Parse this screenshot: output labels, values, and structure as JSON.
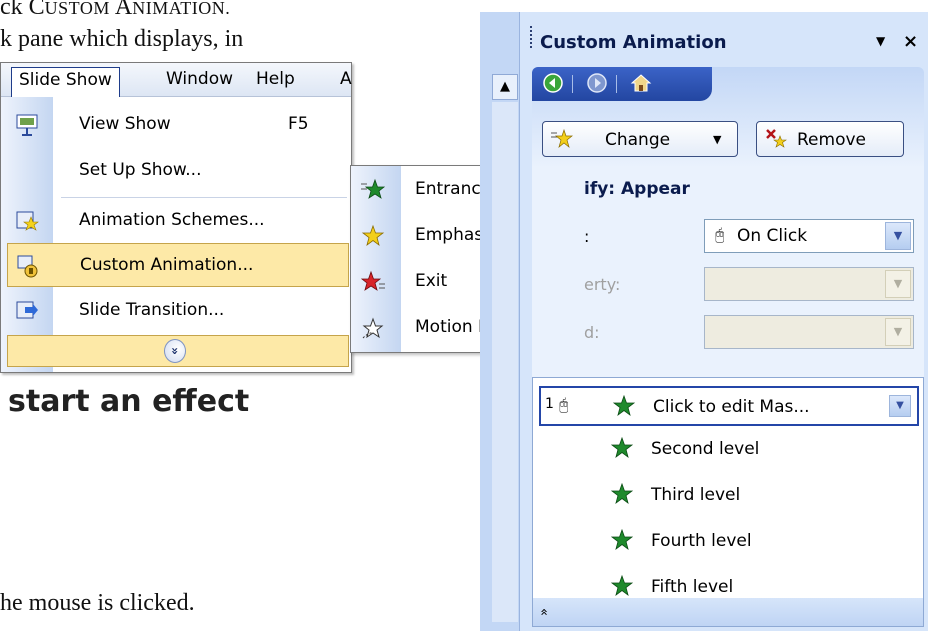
{
  "document": {
    "line1_prefix": "ck ",
    "line1_sc_big1": "C",
    "line1_sc_small1": "USTOM ",
    "line1_sc_big2": "A",
    "line1_sc_small2": "NIMATION.",
    "line2": "k pane which displays, in",
    "heading": "start an effect",
    "footer_line": "he mouse is clicked."
  },
  "menubar": {
    "items": [
      {
        "label": "Slide Show"
      },
      {
        "label": "Window"
      },
      {
        "label": "Help"
      },
      {
        "label": "A"
      }
    ]
  },
  "slide_show_menu": {
    "items": [
      {
        "label": "View Show",
        "shortcut": "F5",
        "icon": "projector-screen-icon"
      },
      {
        "label": "Set Up Show...",
        "icon": ""
      },
      {
        "label": "Animation Schemes...",
        "icon": "animation-schemes-icon"
      },
      {
        "label": "Custom Animation...",
        "icon": "custom-animation-icon"
      },
      {
        "label": "Slide Transition...",
        "icon": "slide-transition-icon"
      }
    ],
    "expand_glyph": "»"
  },
  "effect_submenu": {
    "items": [
      {
        "label": "Entrance",
        "icon": "green-star-icon",
        "color": "#1f8a2c"
      },
      {
        "label": "Emphasis",
        "icon": "yellow-star-icon",
        "color": "#f3cf1a"
      },
      {
        "label": "Exit",
        "icon": "red-star-icon",
        "color": "#d8242a"
      },
      {
        "label": "Motion Paths",
        "icon": "outline-star-icon",
        "color": "#ffffff"
      }
    ]
  },
  "task_pane": {
    "title": "Custom Animation",
    "dropdown_glyph": "▼",
    "close_glyph": "×",
    "change_button": "Change",
    "remove_button": "Remove",
    "modify_label": "ify: Appear",
    "start_label": ":",
    "start_value": "On Click",
    "property_label": "erty:",
    "speed_label": "d:",
    "effects": [
      {
        "order": "1",
        "label": "Click to edit Mas...",
        "trigger": "mouse-icon"
      },
      {
        "label": "Second level"
      },
      {
        "label": "Third level"
      },
      {
        "label": "Fourth level"
      },
      {
        "label": "Fifth level"
      }
    ],
    "collapse_glyph": "»"
  },
  "colors": {
    "pane_bg": "#d6e5fa",
    "nav_blue": "#2a4fae",
    "highlight": "#fde9a7",
    "entrance_star": "#1f8a2c"
  }
}
